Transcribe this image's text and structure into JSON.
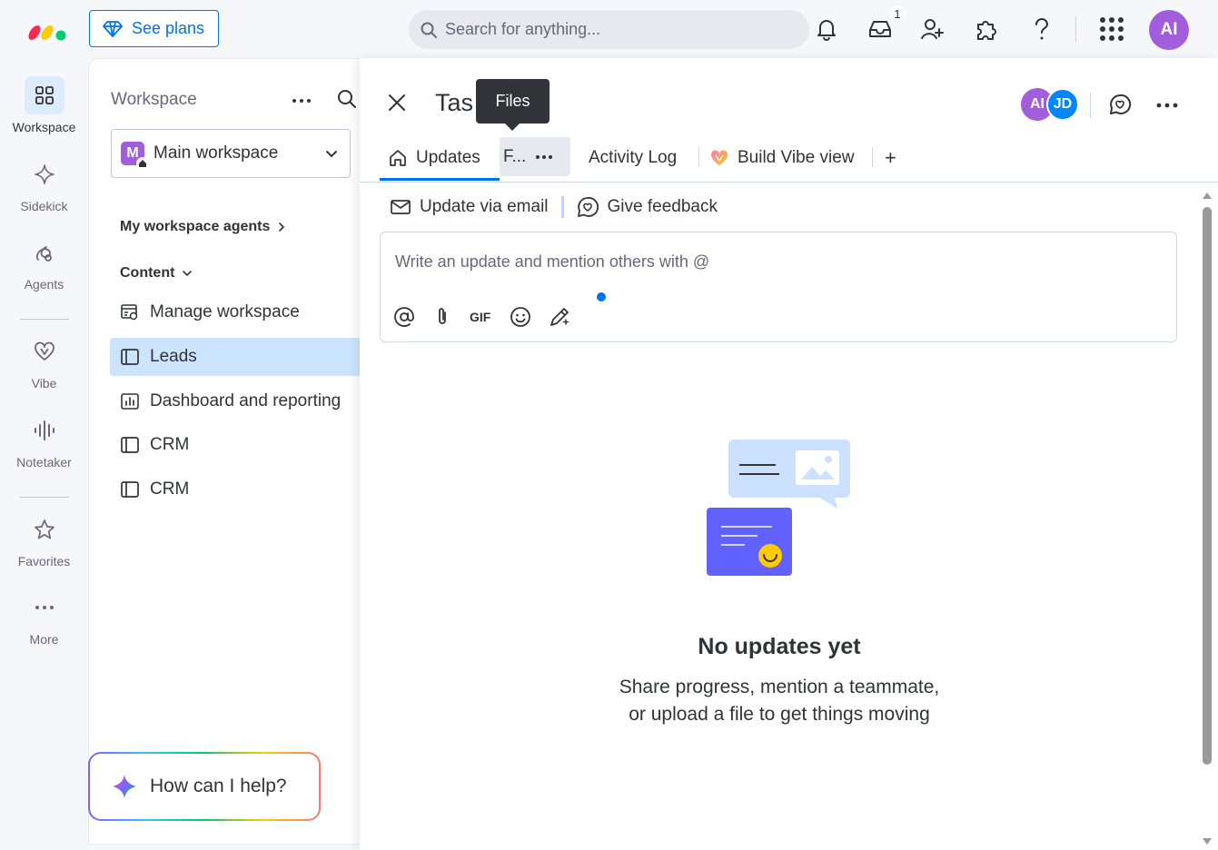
{
  "topbar": {
    "see_plans": "See plans",
    "search_placeholder": "Search for anything...",
    "inbox_badge": "1",
    "avatar_initials": "AI"
  },
  "rail": {
    "items": [
      {
        "label": "Workspace"
      },
      {
        "label": "Sidekick"
      },
      {
        "label": "Agents"
      },
      {
        "label": "Vibe"
      },
      {
        "label": "Notetaker"
      },
      {
        "label": "Favorites"
      },
      {
        "label": "More"
      }
    ]
  },
  "sidebar": {
    "title": "Workspace",
    "workspace_initial": "M",
    "workspace_name": "Main workspace",
    "agents_label": "My workspace agents",
    "content_label": "Content",
    "items": [
      {
        "label": "Manage workspace"
      },
      {
        "label": "Leads"
      },
      {
        "label": "Dashboard and reporting"
      },
      {
        "label": "CRM"
      },
      {
        "label": "CRM"
      }
    ],
    "help_label": "How can I help?"
  },
  "panel": {
    "title": "Tas",
    "tooltip": "Files",
    "avatars": [
      "AI",
      "JD"
    ],
    "tabs": {
      "updates": "Updates",
      "files_short": "F...",
      "activity": "Activity Log",
      "vibe": "Build Vibe view",
      "add": "+"
    },
    "sub_actions": {
      "email": "Update via email",
      "feedback": "Give feedback"
    },
    "composer_placeholder": "Write an update and mention others with @",
    "gif_label": "GIF",
    "empty_title": "No updates yet",
    "empty_line1": "Share progress, mention a teammate,",
    "empty_line2": "or upload a file to get things moving"
  },
  "colors": {
    "accent": "#0073ea",
    "active_nav": "#cce5ff",
    "avatar_purple": "#a25ddc",
    "avatar_blue": "#0086ff"
  }
}
